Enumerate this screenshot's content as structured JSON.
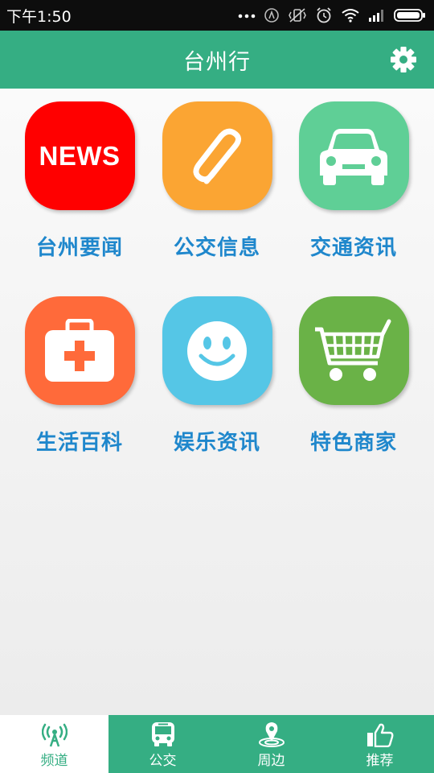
{
  "status_bar": {
    "time": "下午1:50"
  },
  "header": {
    "title": "台州行",
    "settings_icon": "gear-icon",
    "background": "#35ae83"
  },
  "tiles": [
    {
      "label": "台州要闻",
      "icon": "news-icon",
      "icon_text": "NEWS",
      "color": "#ff0000"
    },
    {
      "label": "公交信息",
      "icon": "paperclip-icon",
      "color": "#fba533"
    },
    {
      "label": "交通资讯",
      "icon": "car-icon",
      "color": "#5fcf96"
    },
    {
      "label": "生活百科",
      "icon": "first-aid-kit-icon",
      "color": "#ff6a3a"
    },
    {
      "label": "娱乐资讯",
      "icon": "smiley-icon",
      "color": "#55c6e6"
    },
    {
      "label": "特色商家",
      "icon": "shopping-cart-icon",
      "color": "#6ab247"
    }
  ],
  "bottom_nav": {
    "items": [
      {
        "label": "频道",
        "icon": "antenna-icon",
        "active": true
      },
      {
        "label": "公交",
        "icon": "bus-icon",
        "active": false
      },
      {
        "label": "周边",
        "icon": "location-pin-icon",
        "active": false
      },
      {
        "label": "推荐",
        "icon": "thumbs-up-icon",
        "active": false
      }
    ]
  },
  "colors": {
    "accent": "#35ae83",
    "label_blue": "#1f87cc"
  }
}
